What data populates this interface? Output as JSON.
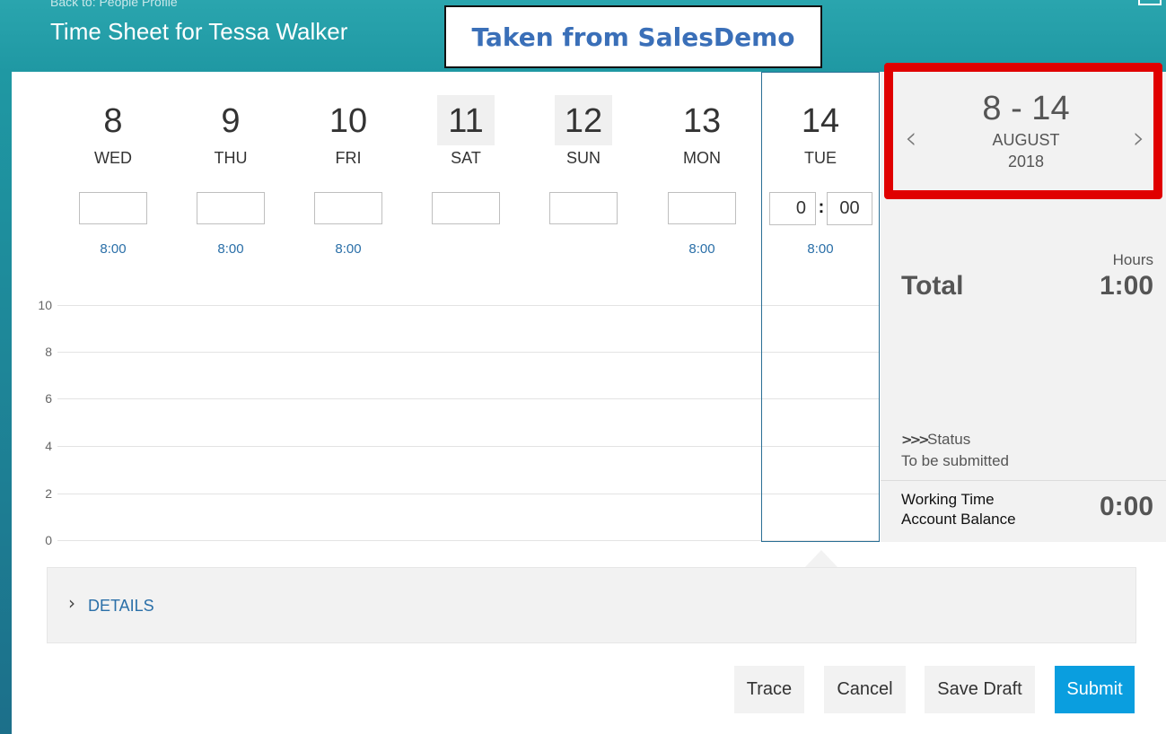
{
  "header": {
    "back_link": "Back to: People Profile",
    "title": "Time Sheet for Tessa Walker"
  },
  "watermark": "Taken from SalesDemo",
  "days": [
    {
      "num": "8",
      "name": "WED",
      "target": "8:00",
      "weekend": false
    },
    {
      "num": "9",
      "name": "THU",
      "target": "8:00",
      "weekend": false
    },
    {
      "num": "10",
      "name": "FRI",
      "target": "8:00",
      "weekend": false
    },
    {
      "num": "11",
      "name": "SAT",
      "target": "",
      "weekend": true
    },
    {
      "num": "12",
      "name": "SUN",
      "target": "",
      "weekend": true
    },
    {
      "num": "13",
      "name": "MON",
      "target": "8:00",
      "weekend": false
    },
    {
      "num": "14",
      "name": "TUE",
      "target": "8:00",
      "weekend": false
    }
  ],
  "time_entry": {
    "hours": "0",
    "separator": ":",
    "minutes": "00"
  },
  "y_axis": [
    "10",
    "8",
    "6",
    "4",
    "2",
    "0"
  ],
  "period": {
    "range": "8 - 14",
    "month": "AUGUST",
    "year": "2018",
    "prev_icon": "chevron-left-icon",
    "next_icon": "chevron-right-icon"
  },
  "summary": {
    "hours_label": "Hours",
    "total_label": "Total",
    "total_value": "1:00",
    "status_label": "Status",
    "status_value": "To be submitted",
    "balance_label_1": "Working Time",
    "balance_label_2": "Account Balance",
    "balance_value": "0:00"
  },
  "details": {
    "label": "DETAILS"
  },
  "buttons": {
    "trace": "Trace",
    "cancel": "Cancel",
    "save_draft": "Save Draft",
    "submit": "Submit"
  },
  "colors": {
    "header": "#22a0aa",
    "accent": "#0a9edf",
    "link": "#2a6fa8",
    "highlight": "#e00000"
  }
}
